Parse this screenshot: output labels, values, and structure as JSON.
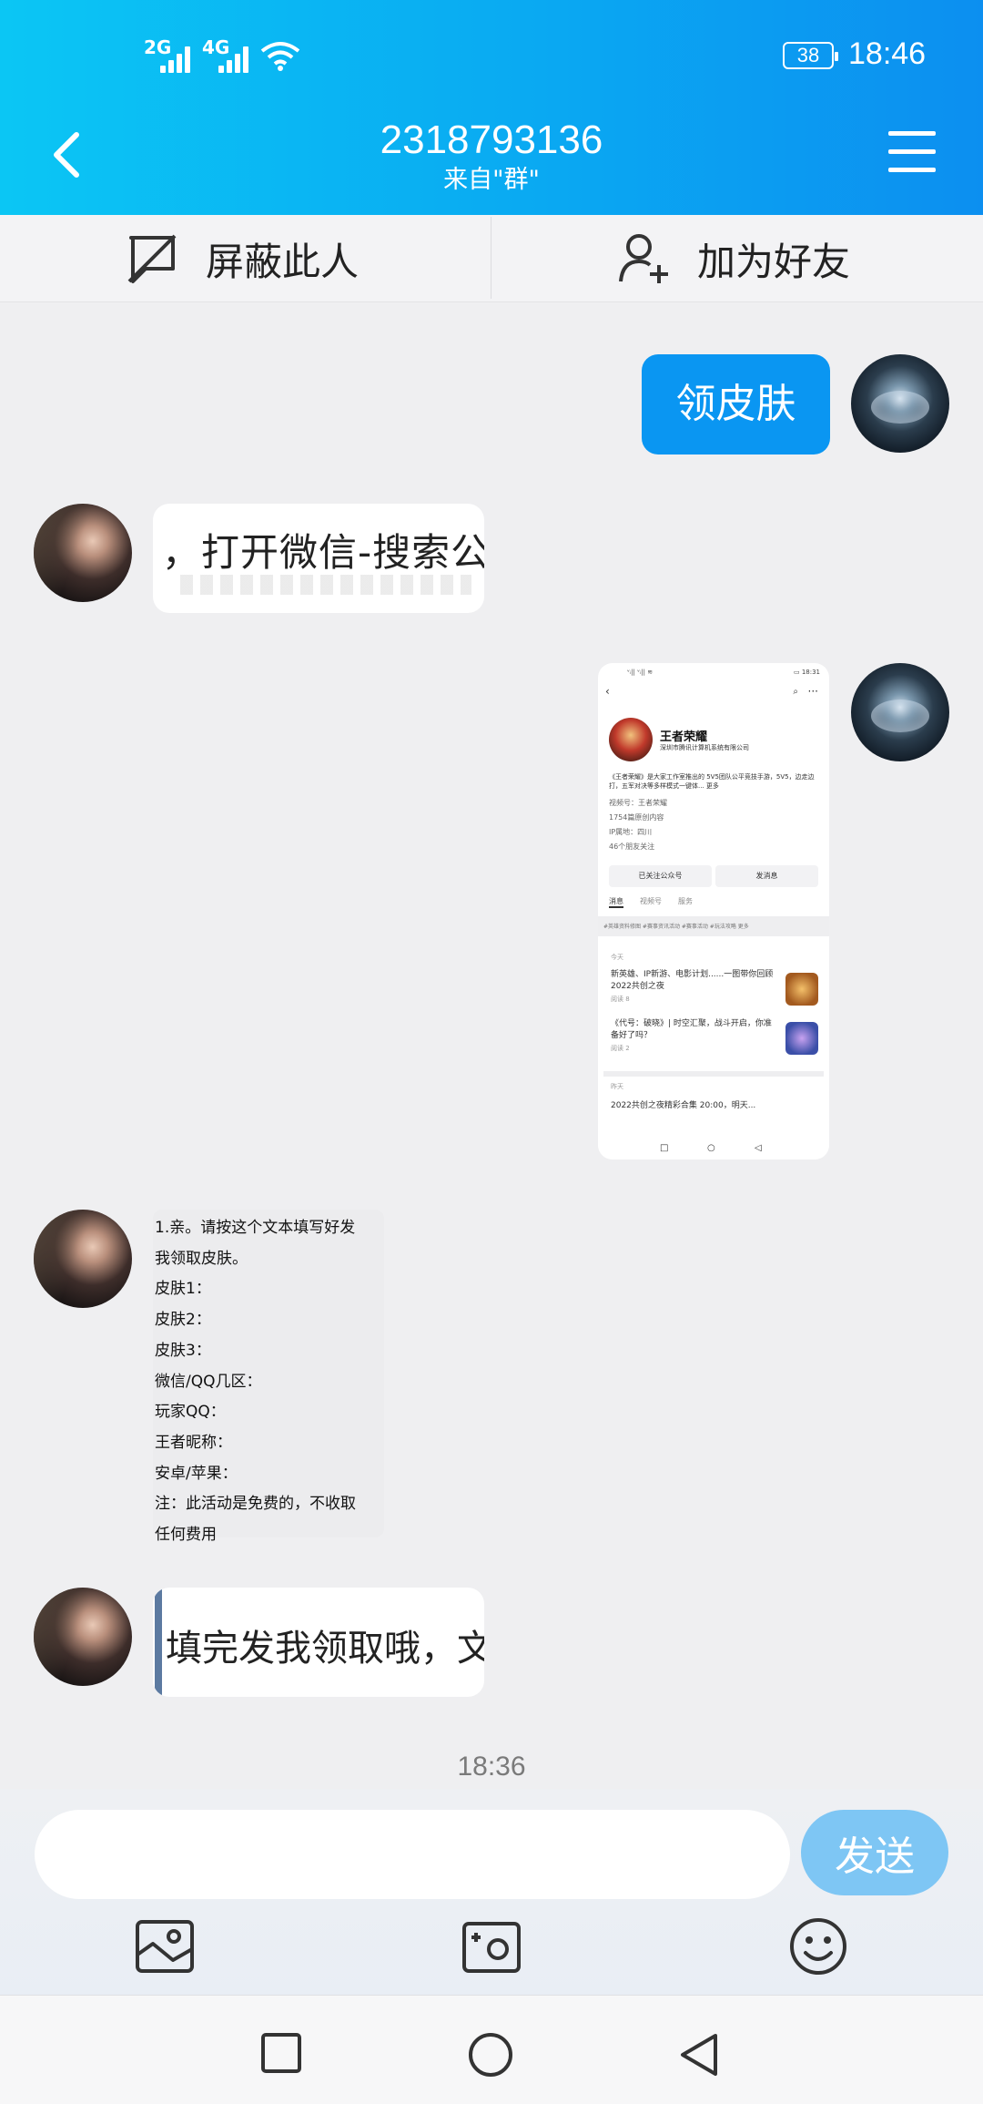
{
  "status_bar": {
    "signal1_label": "2G",
    "signal2_label": "4G",
    "battery": "38",
    "time": "18:46"
  },
  "header": {
    "title": "2318793136",
    "subtitle": "来自\"群\""
  },
  "actions": {
    "block_label": "屏蔽此人",
    "add_friend_label": "加为好友"
  },
  "messages": {
    "m1_text": "领皮肤",
    "m2_image_text": "，打开微信-搜索公众",
    "m3_screenshot": {
      "account_name": "王者荣耀",
      "company": "深圳市腾讯计算机系统有限公司",
      "desc": "《王者荣耀》是大家工作室推出的 5V5团队公平竞技手游，5V5，边走边打，五军对决等多样模式一键体...  更多",
      "video_id": "视频号：王者荣耀",
      "original_count": "1754篇原创内容",
      "ip": "IP属地：四川",
      "friends": "46个朋友关注",
      "followed_btn": "已关注公众号",
      "send_btn": "发消息",
      "tabs": [
        "消息",
        "视频号",
        "服务"
      ],
      "tags": "#英雄资料修图 #赛事资讯活动 #赛事活动 #玩法攻略 更多",
      "card1_label": "今天",
      "card1_item1": "新英雄、IP新游、电影计划......一图带你回顾2022共创之夜",
      "card1_item1_meta": "阅读 8",
      "card1_item2": "《代号：破晓》| 时空汇聚，战斗开启，你准备好了吗？",
      "card1_item2_meta": "阅读 2",
      "card2_label": "昨天",
      "card2_item1": "2022共创之夜精彩合集 20:00，明天..."
    },
    "m4_lines": [
      "1.亲。请按这个文本填写好发",
      "我领取皮肤。",
      "皮肤1：",
      "皮肤2：",
      "皮肤3：",
      "微信/QQ几区：",
      "玩家QQ：",
      "王者昵称：",
      "安卓/苹果：",
      "注：此活动是免费的，不收取",
      "任何费用"
    ],
    "m5_image_text": "填完发我领取哦，文字",
    "timestamp": "18:36"
  },
  "input": {
    "placeholder": "",
    "send_label": "发送"
  },
  "icons": {
    "back": "back-arrow-icon",
    "menu": "menu-icon",
    "block": "block-icon",
    "add_friend": "add-friend-icon",
    "gallery": "gallery-icon",
    "camera": "camera-icon",
    "emoji": "emoji-icon"
  },
  "colors": {
    "header_start": "#0bc6f4",
    "header_end": "#0c8ff0",
    "my_bubble": "#0a96f2",
    "send_button": "#7ec6f4"
  }
}
